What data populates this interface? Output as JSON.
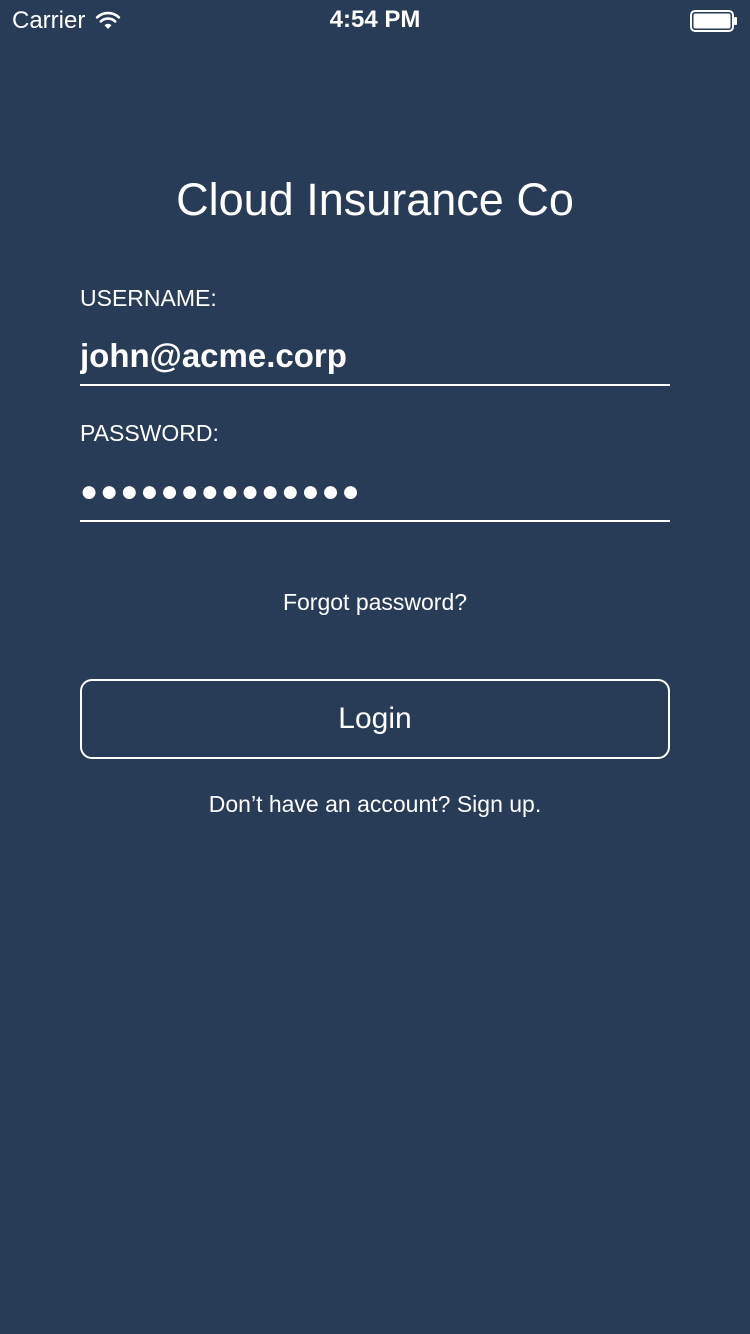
{
  "status_bar": {
    "carrier": "Carrier",
    "time": "4:54 PM",
    "wifi_icon": "wifi-icon",
    "battery_icon": "battery-icon",
    "battery_level": 1.0
  },
  "app": {
    "title": "Cloud Insurance Co"
  },
  "form": {
    "username_label": "USERNAME:",
    "username_value": "john@acme.corp",
    "password_label": "PASSWORD:",
    "password_value": "●●●●●●●●●●●●●●",
    "forgot_password": "Forgot password?",
    "login_button": "Login",
    "signup_prompt": "Don’t have an account? Sign up."
  },
  "colors": {
    "background": "#283c57",
    "foreground": "#ffffff"
  }
}
